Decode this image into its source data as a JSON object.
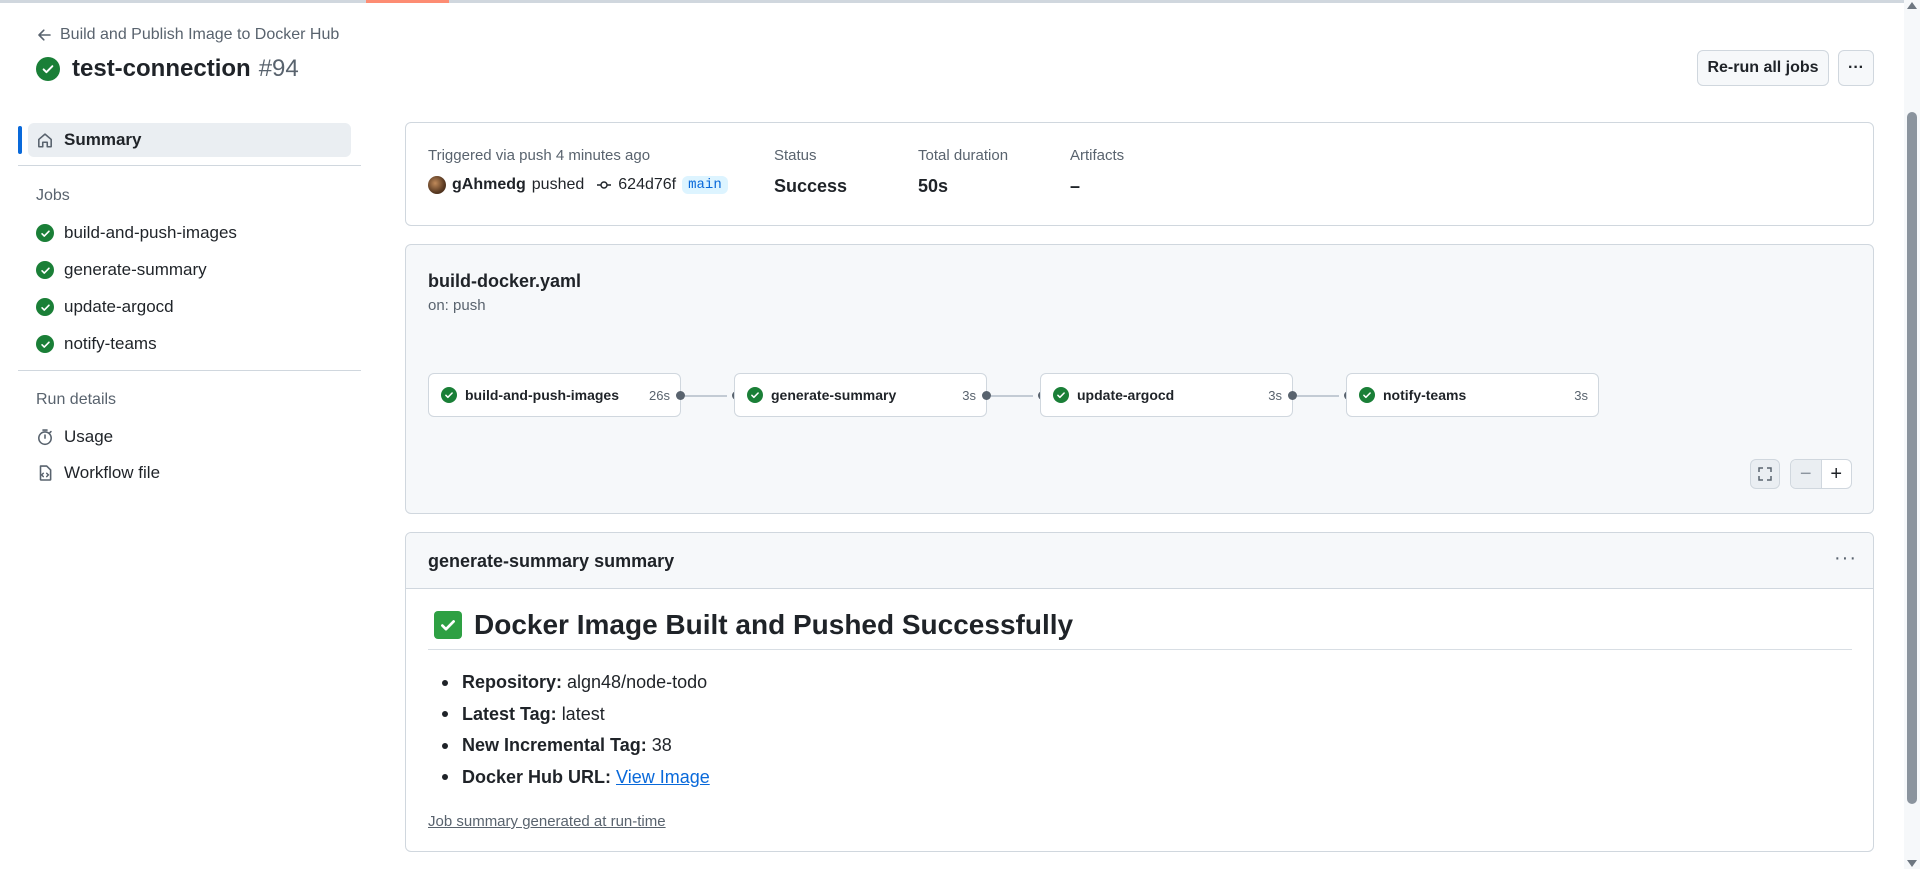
{
  "header": {
    "back_label": "Build and Publish Image to Docker Hub",
    "title": "test-connection",
    "run_number": "#94",
    "rerun_label": "Re-run all jobs",
    "more_label": "···"
  },
  "sidebar": {
    "summary_label": "Summary",
    "jobs_heading": "Jobs",
    "jobs": [
      {
        "label": "build-and-push-images"
      },
      {
        "label": "generate-summary"
      },
      {
        "label": "update-argocd"
      },
      {
        "label": "notify-teams"
      }
    ],
    "run_details_heading": "Run details",
    "usage_label": "Usage",
    "workflow_file_label": "Workflow file"
  },
  "info": {
    "triggered_label": "Triggered via push 4 minutes ago",
    "user": "gAhmedg",
    "pushed_word": "pushed",
    "commit": "624d76f",
    "branch": "main",
    "status_label": "Status",
    "status_value": "Success",
    "duration_label": "Total duration",
    "duration_value": "50s",
    "artifacts_label": "Artifacts",
    "artifacts_value": "–"
  },
  "graph": {
    "file": "build-docker.yaml",
    "trigger": "on: push",
    "jobs": [
      {
        "name": "build-and-push-images",
        "duration": "26s"
      },
      {
        "name": "generate-summary",
        "duration": "3s"
      },
      {
        "name": "update-argocd",
        "duration": "3s"
      },
      {
        "name": "notify-teams",
        "duration": "3s"
      }
    ],
    "zoom_minus": "−",
    "zoom_plus": "+"
  },
  "summary": {
    "heading": "generate-summary summary",
    "more_label": "···",
    "h1": "Docker Image Built and Pushed Successfully",
    "items": [
      {
        "key": "Repository:",
        "value": "algn48/node-todo"
      },
      {
        "key": "Latest Tag:",
        "value": "latest"
      },
      {
        "key": "New Incremental Tag:",
        "value": "38"
      },
      {
        "key": "Docker Hub URL:",
        "link": "View Image"
      }
    ],
    "footer": "Job summary generated at run-time"
  },
  "colors": {
    "success": "#1a7f37",
    "accent": "#0969da",
    "tab_underline": "#fd8c73"
  }
}
